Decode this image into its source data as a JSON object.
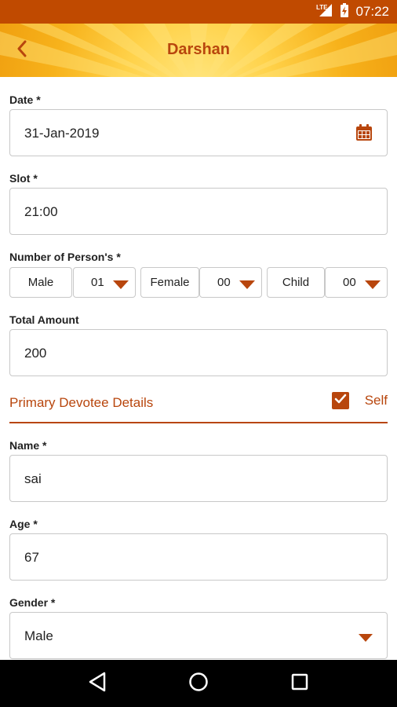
{
  "status_bar": {
    "time": "07:22",
    "network": "LTE"
  },
  "header": {
    "title": "Darshan",
    "back_icon": "back-arrow-icon"
  },
  "form": {
    "date": {
      "label": "Date *",
      "value": "31-Jan-2019",
      "icon": "calendar-icon"
    },
    "slot": {
      "label": "Slot *",
      "value": "21:00"
    },
    "persons": {
      "label": "Number of Person's *",
      "male_label": "Male",
      "male_value": "01",
      "female_label": "Female",
      "female_value": "00",
      "child_label": "Child",
      "child_value": "00"
    },
    "total_amount": {
      "label": "Total Amount",
      "value": "200"
    },
    "primary_devotee": {
      "title": "Primary Devotee Details",
      "self_label": "Self",
      "self_checked": true
    },
    "name": {
      "label": "Name *",
      "value": "sai"
    },
    "age": {
      "label": "Age *",
      "value": "67"
    },
    "gender": {
      "label": "Gender *",
      "value": "Male"
    }
  },
  "colors": {
    "accent": "#b8460d",
    "status_bar": "#c04a00",
    "header_yellow": "#f7b21b"
  }
}
